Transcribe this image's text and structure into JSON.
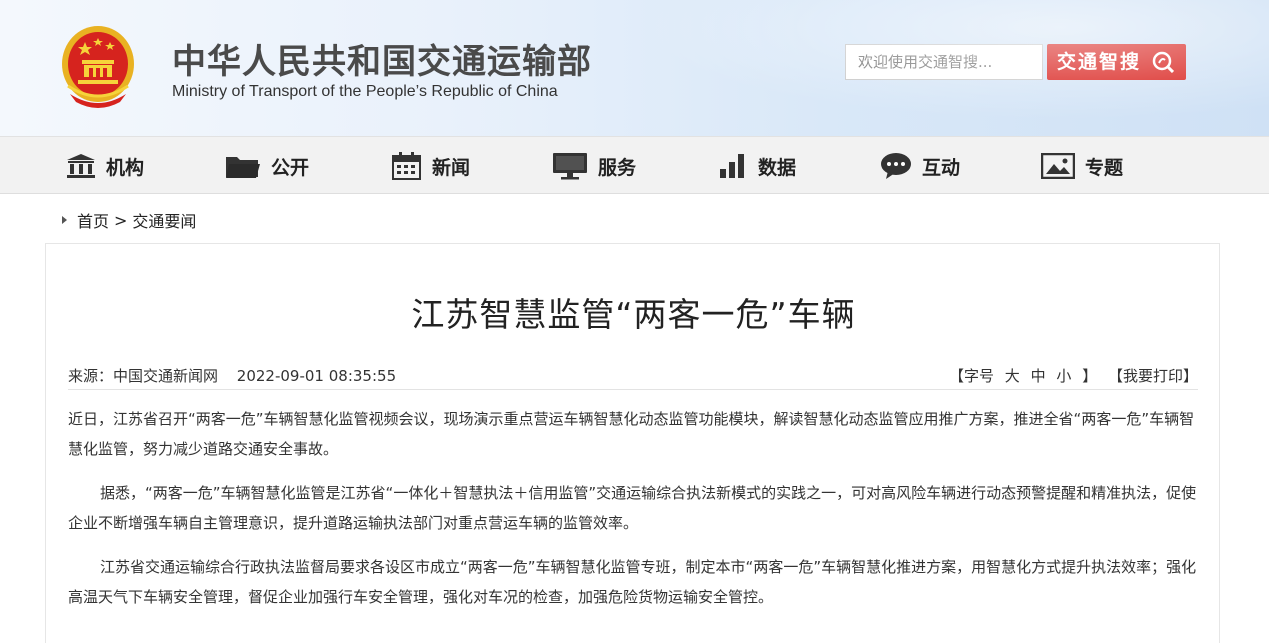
{
  "header": {
    "site_name_cn": "中华人民共和国交通运输部",
    "site_name_en": "Ministry of Transport of the People’s Republic of China",
    "search_placeholder": "欢迎使用交通智搜...",
    "search_button": "交通智搜"
  },
  "nav": {
    "items": [
      {
        "label": "机构",
        "icon": "institution-icon"
      },
      {
        "label": "公开",
        "icon": "folder-icon"
      },
      {
        "label": "新闻",
        "icon": "calendar-icon"
      },
      {
        "label": "服务",
        "icon": "monitor-icon"
      },
      {
        "label": "数据",
        "icon": "bar-chart-icon"
      },
      {
        "label": "互动",
        "icon": "chat-icon"
      },
      {
        "label": "专题",
        "icon": "image-icon"
      }
    ]
  },
  "breadcrumb": {
    "home": "首页",
    "separator": ">",
    "current": "交通要闻"
  },
  "article": {
    "title": "江苏智慧监管“两客一危”车辆",
    "source_label": "来源：中国交通新闻网",
    "datetime": "2022-09-01 08:35:55",
    "font_size_label": "【字号",
    "font_large": "大",
    "font_medium": "中",
    "font_small": "小",
    "font_close": "】",
    "print_label": "【我要打印】",
    "paragraphs": [
      "近日，江苏省召开“两客一危”车辆智慧化监管视频会议，现场演示重点营运车辆智慧化动态监管功能模块，解读智慧化动态监管应用推广方案，推进全省“两客一危”车辆智慧化监管，努力减少道路交通安全事故。",
      "据悉，“两客一危”车辆智慧化监管是江苏省“一体化＋智慧执法＋信用监管”交通运输综合执法新模式的实践之一，可对高风险车辆进行动态预警提醒和精准执法，促使企业不断增强车辆自主管理意识，提升道路运输执法部门对重点营运车辆的监管效率。",
      "江苏省交通运输综合行政执法监督局要求各设区市成立“两客一危”车辆智慧化监管专班，制定本市“两客一危”车辆智慧化推进方案，用智慧化方式提升执法效率；强化高温天气下车辆安全管理，督促企业加强行车安全管理，强化对车况的检查，加强危险货物运输安全管控。"
    ]
  },
  "colors": {
    "brand_red": "#d9221e",
    "nav_bg": "#f2f2f2"
  }
}
